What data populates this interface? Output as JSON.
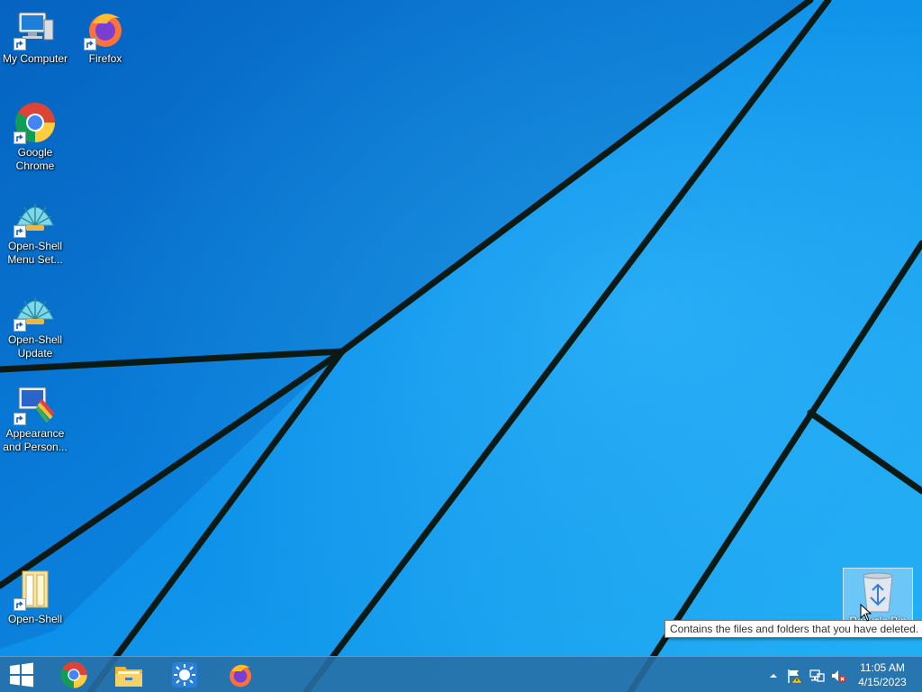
{
  "desktop": {
    "icons": [
      {
        "label": "My Computer",
        "icon": "computer-icon"
      },
      {
        "label": "Firefox",
        "icon": "firefox-icon"
      },
      {
        "label": "Google\nChrome",
        "icon": "chrome-icon"
      },
      {
        "label": "Open-Shell\nMenu Set...",
        "icon": "open-shell-icon"
      },
      {
        "label": "Open-Shell\nUpdate",
        "icon": "open-shell-icon"
      },
      {
        "label": "Appearance\nand Person...",
        "icon": "appearance-icon"
      },
      {
        "label": "Open-Shell",
        "icon": "folder-icon"
      }
    ],
    "recycle_bin": {
      "label": "Recycle Bin",
      "icon": "recycle-bin-icon"
    },
    "tooltip": "Contains the files and folders that you have deleted."
  },
  "taskbar": {
    "items": [
      {
        "name": "start",
        "icon": "windows-logo-icon"
      },
      {
        "name": "Google Chrome",
        "icon": "chrome-icon"
      },
      {
        "name": "File Explorer",
        "icon": "folder-icon"
      },
      {
        "name": "Open-Shell",
        "icon": "sun-icon"
      },
      {
        "name": "Firefox",
        "icon": "firefox-icon"
      }
    ],
    "tray": {
      "icons": [
        "chevron-up-icon",
        "flag-warning-icon",
        "network-icon",
        "speaker-muted-icon"
      ],
      "time": "11:05 AM",
      "date": "4/15/2023"
    }
  },
  "colors": {
    "wallpaper": "#0b8ee8",
    "line": "#0a1a14",
    "taskbar": "#2b6ea6"
  }
}
